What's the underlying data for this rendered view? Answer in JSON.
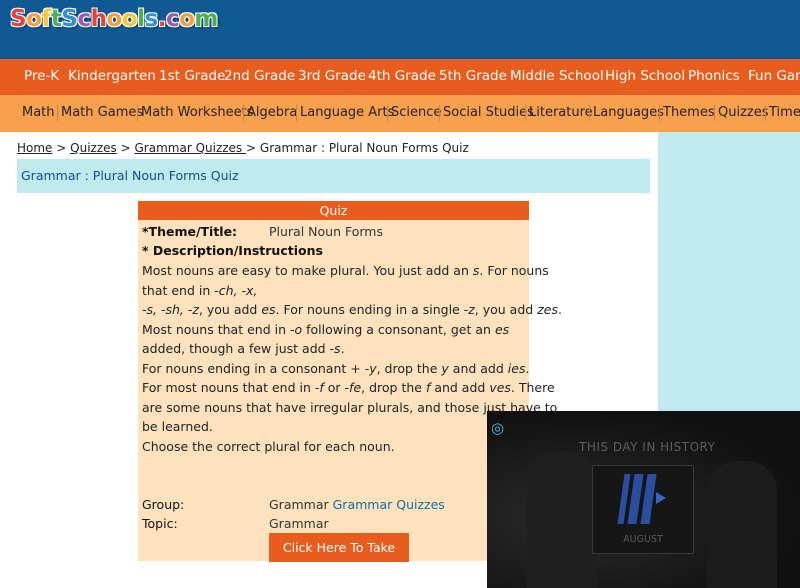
{
  "logo": {
    "text": "SoftSchools.com",
    "letters": [
      "S",
      "o",
      "f",
      "t",
      "S",
      "c",
      "h",
      "o",
      "o",
      "l",
      "s",
      ".",
      "c",
      "o",
      "m"
    ],
    "colors": [
      "#e8413c",
      "#f7a03b",
      "#f7c73b",
      "#4caf50",
      "#2f8fd8",
      "#9b59b6",
      "#e8413c",
      "#f7a03b",
      "#f7c73b",
      "#4caf50",
      "#2f8fd8",
      "#e8413c",
      "#9b59b6",
      "#f7a03b",
      "#4caf50"
    ]
  },
  "nav_primary": [
    "Pre-K",
    "Kindergarten",
    "1st Grade",
    "2nd Grade",
    "3rd Grade",
    "4th Grade",
    "5th Grade",
    "Middle School",
    "High School",
    "Phonics",
    "Fun Gam"
  ],
  "nav_secondary": [
    "Math",
    "Math Games",
    "Math Worksheets",
    "Algebra",
    "Language Arts",
    "Science",
    "Social Studies",
    "Literature",
    "Languages",
    "Themes",
    "Quizzes",
    "Timel"
  ],
  "breadcrumb": {
    "home": "Home",
    "sep": ">",
    "quizzes": "Quizzes",
    "grammar_quizzes": "Grammar Quizzes ",
    "current": "Grammar : Plural Noun Forms Quiz"
  },
  "page_title": "Grammar : Plural Noun Forms Quiz",
  "quiz": {
    "header": "Quiz",
    "theme_label": "*Theme/Title:",
    "theme_value": "Plural Noun Forms",
    "desc_label": "* Description/Instructions",
    "description_lines": [
      "Most nouns are easy to make plural. You just add an <i>s</i>. For nouns",
      "that end in <i>-ch, -x,</i>",
      "<i>-s, -sh, -z</i>, you add <i>es</i>. For nouns ending in a single <i>-z</i>, you add <i>zes</i>.",
      "Most nouns that end in <i>-o</i> following a consonant, get an <i>es</i>",
      "added, though a few just add <i>-s</i>.",
      "For nouns ending in a consonant + <i>-y</i>, drop the <i>y</i> and add <i>ies</i>.",
      "For most nouns that end in <i>-f</i> or <i>-fe</i>, drop the <i>f</i> and add <i>ves</i>. There",
      "are some nouns that have irregular plurals, and those just have to",
      "be learned.",
      "Choose the correct plural for each noun."
    ],
    "group_label": "Group:",
    "group_value": "Grammar",
    "group_link": "Grammar Quizzes",
    "topic_label": "Topic:",
    "topic_value": "Grammar",
    "take_test_button": "Click Here To Take Test"
  },
  "video": {
    "title": "THIS DAY IN HISTORY",
    "poster_month": "AUGUST",
    "logo_icon": "player-logo-icon"
  },
  "colors": {
    "header_blue": "#0f5a95",
    "nav_orange": "#e85d1d",
    "nav_light_orange": "#f7a04e",
    "light_cyan": "#bfeaee",
    "quiz_bg": "#fde2bd"
  }
}
